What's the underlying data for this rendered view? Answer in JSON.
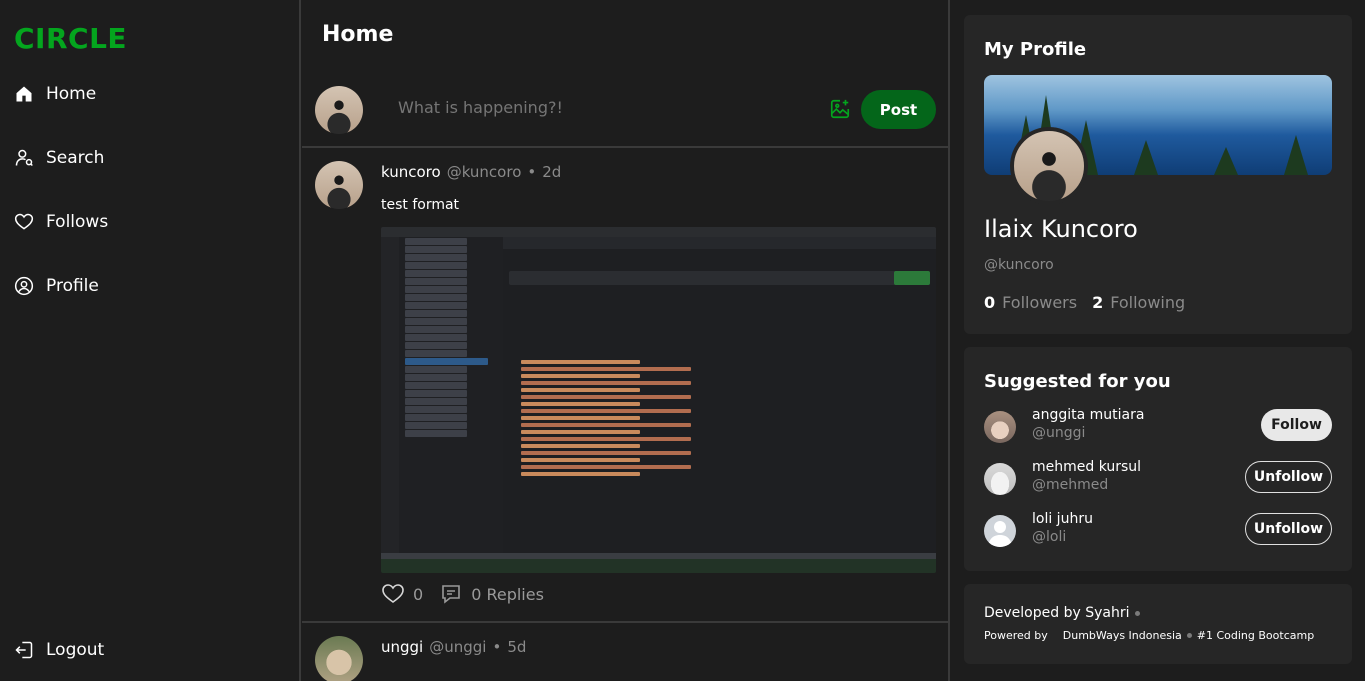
{
  "brand": {
    "logo": "CIRCLE",
    "accent": "#04a51e"
  },
  "nav": {
    "items": [
      {
        "label": "Home",
        "icon": "home-icon"
      },
      {
        "label": "Search",
        "icon": "user-search-icon"
      },
      {
        "label": "Follows",
        "icon": "heart-icon"
      },
      {
        "label": "Profile",
        "icon": "user-circle-icon"
      }
    ],
    "logout": "Logout"
  },
  "main": {
    "title": "Home",
    "composer": {
      "placeholder": "What is happening?!",
      "post_label": "Post"
    },
    "threads": [
      {
        "name": "kuncoro",
        "handle": "@kuncoro",
        "separator": "•",
        "age": "2d",
        "text": "test format",
        "likes": "0",
        "replies": "0 Replies"
      },
      {
        "name": "unggi",
        "handle": "@unggi",
        "separator": "•",
        "age": "5d"
      }
    ]
  },
  "profile": {
    "title": "My Profile",
    "name": "Ilaix Kuncoro",
    "handle": "@kuncoro",
    "followers_count": "0",
    "followers_label": "Followers",
    "following_count": "2",
    "following_label": "Following"
  },
  "suggested": {
    "title": "Suggested for you",
    "users": [
      {
        "name": "anggita mutiara",
        "handle": "@unggi",
        "action": "Follow"
      },
      {
        "name": "mehmed kursul",
        "handle": "@mehmed",
        "action": "Unfollow"
      },
      {
        "name": "loli juhru",
        "handle": "@loli",
        "action": "Unfollow"
      }
    ]
  },
  "footer": {
    "developed": "Developed by Syahri",
    "powered": "Powered by",
    "company": "DumbWays Indonesia",
    "tagline": "#1 Coding Bootcamp"
  }
}
